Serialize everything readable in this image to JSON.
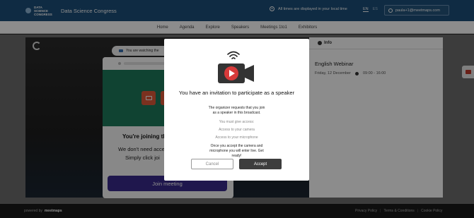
{
  "header": {
    "logo_text": "DATA SCIENCE CONGRESS",
    "app_title": "Data Science Congress",
    "timezone_text": "All times are displayed in your local time",
    "languages": [
      "EN",
      "ES"
    ],
    "user_email": "paula+1@meetmaps.com"
  },
  "nav": {
    "items": [
      "Home",
      "Agenda",
      "Explore",
      "Speakers",
      "Meetings 1to1",
      "Exhibitors"
    ]
  },
  "info_panel": {
    "tab_label": "Info",
    "event_title": "English Webinar",
    "event_date": "Friday, 12 December",
    "event_time": "09:00 - 16:00"
  },
  "room": {
    "notice": "You are watching the",
    "heading": "You're joining thi",
    "text_line1": "We don't need acce",
    "text_line2": "Simply click joi",
    "join_button": "Join meeting"
  },
  "modal": {
    "title": "You have an invitation to participate as a speaker",
    "subtitle": "The organizer requests that you join as a speaker in this broadcast.",
    "requirements": [
      "You must give access:",
      "Access to your camera",
      "Access to your microphone"
    ],
    "note": "Once you accept the camera and microphone you will enter live. Get ready!",
    "cancel_label": "Cancel",
    "accept_label": "Accept"
  },
  "footer": {
    "powered_by": "powered by",
    "brand": "meetmaps",
    "links": [
      "Privacy Policy",
      "Terms & Conditions",
      "Cookie Policy"
    ]
  },
  "colors": {
    "header_bg": "#1d4f7a",
    "join_button": "#3a2a8c",
    "accept_button": "#3d3d3d",
    "video_bg": "#1e7a5c",
    "camera_icon_red": "#d63a3a"
  }
}
